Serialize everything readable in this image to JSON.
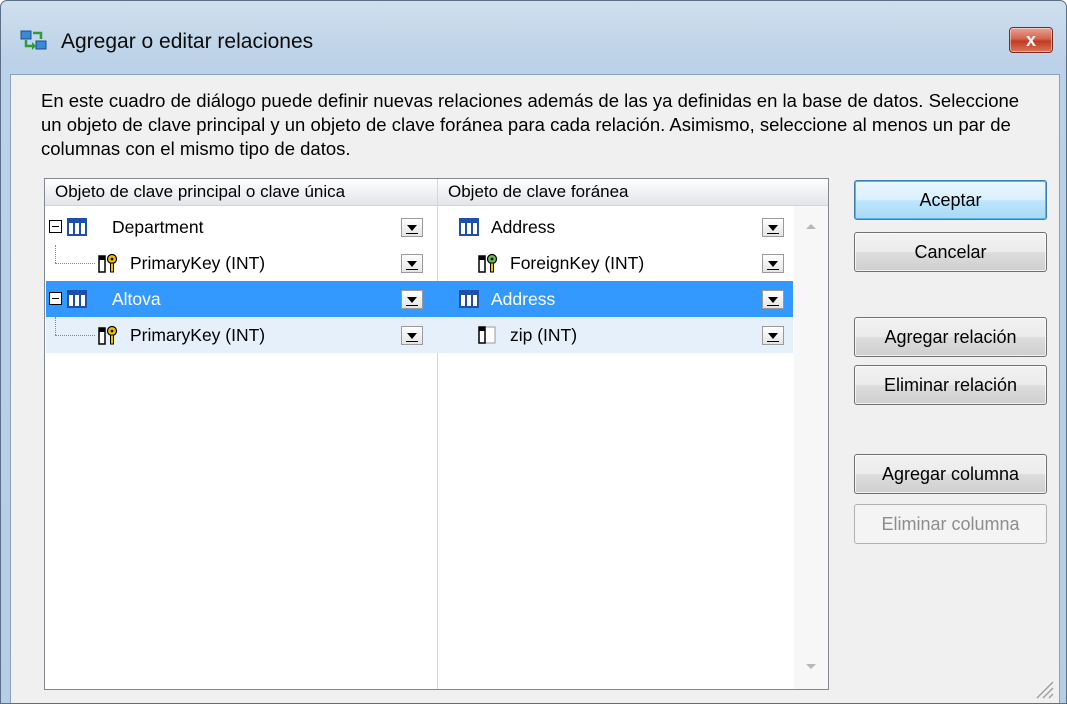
{
  "window": {
    "title": "Agregar o editar relaciones",
    "close_label": "x"
  },
  "description": "En este cuadro de diálogo puede definir nuevas relaciones además de las ya definidas en la base de datos. Seleccione un objeto de clave principal y un objeto de clave foránea para cada relación. Asimismo, seleccione al menos un par de columnas con el mismo tipo de datos.",
  "grid": {
    "columns": [
      "Objeto de clave principal o clave única",
      "Objeto de clave foránea"
    ],
    "rows": [
      {
        "primary": "Department",
        "foreign": "Address",
        "kind": "table",
        "selected": false
      },
      {
        "primary": "PrimaryKey (INT)",
        "foreign": "ForeignKey (INT)",
        "kind": "key-key",
        "selected": false
      },
      {
        "primary": "Altova",
        "foreign": "Address",
        "kind": "table",
        "selected": true
      },
      {
        "primary": "PrimaryKey (INT)",
        "foreign": "zip (INT)",
        "kind": "key-column",
        "selected": false
      }
    ]
  },
  "buttons": {
    "ok": "Aceptar",
    "cancel": "Cancelar",
    "add_relation": "Agregar relación",
    "delete_relation": "Eliminar relación",
    "add_column": "Agregar columna",
    "delete_column": "Eliminar columna"
  },
  "colors": {
    "selection": "#3399ff",
    "title_gradient": "#bcd2e8",
    "close_button": "#c23b22"
  },
  "icons": [
    "relations-app-icon",
    "close-icon",
    "table-icon",
    "primary-key-icon",
    "foreign-key-icon",
    "column-icon",
    "dropdown-arrow-icon",
    "resize-grip-icon"
  ]
}
